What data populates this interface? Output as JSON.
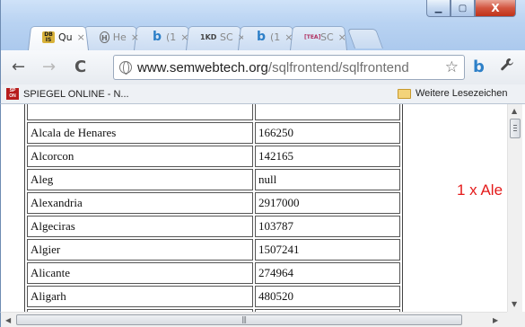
{
  "window": {
    "controls": {
      "minimize": "▁",
      "maximize": "▢",
      "close": "X"
    }
  },
  "tabs": [
    {
      "favicon": "{DB\nis}",
      "icon": "db-icon",
      "label": "Qu",
      "active": true
    },
    {
      "favicon": "H",
      "icon": "heise-icon",
      "label": "He",
      "active": false
    },
    {
      "favicon": "b",
      "icon": "b-icon",
      "label": "(1",
      "active": false
    },
    {
      "favicon": "1KD",
      "icon": "kd-icon",
      "label": "SC",
      "active": false
    },
    {
      "favicon": "b",
      "icon": "b-icon",
      "label": "(1",
      "active": false
    },
    {
      "favicon": "[TEA]",
      "icon": "tea-icon",
      "label": "SC",
      "active": false
    }
  ],
  "tab_close": "×",
  "toolbar": {
    "back": "←",
    "forward": "→",
    "reload": "C",
    "url_host": "www.semwebtech.org",
    "url_path": "/sqlfrontend/sqlfrontend",
    "star": "☆",
    "extension_glyph": "b",
    "wrench_glyph": "🔧"
  },
  "bookmarks": {
    "left_label": "SPIEGEL ONLINE - N...",
    "right_label": "Weitere Lesezeichen"
  },
  "table": {
    "rows": [
      {
        "city": "",
        "population": ""
      },
      {
        "city": "Alcala de Henares",
        "population": "166250"
      },
      {
        "city": "Alcorcon",
        "population": "142165"
      },
      {
        "city": "Aleg",
        "population": "null"
      },
      {
        "city": "Alexandria",
        "population": "2917000"
      },
      {
        "city": "Algeciras",
        "population": "103787"
      },
      {
        "city": "Algier",
        "population": "1507241"
      },
      {
        "city": "Alicante",
        "population": "274964"
      },
      {
        "city": "Aligarh",
        "population": "480520"
      },
      {
        "city": "",
        "population": ""
      }
    ]
  },
  "side_note": "1 x Ale",
  "scrollbars": {
    "up": "▲",
    "down": "▼",
    "left": "◀",
    "right": "▶",
    "grip_h": "|||"
  }
}
